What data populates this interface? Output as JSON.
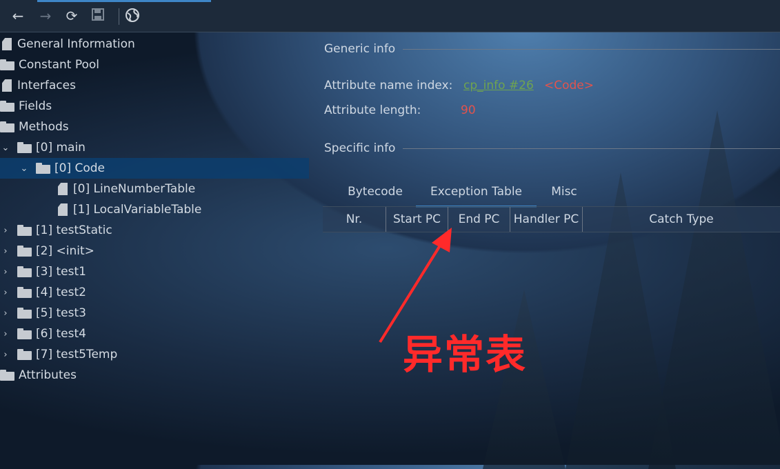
{
  "toolbar": {
    "icons": [
      "back-arrow-icon",
      "forward-arrow-icon",
      "refresh-icon",
      "save-icon",
      "globe-icon"
    ]
  },
  "tree": {
    "items": [
      {
        "label": "General Information"
      },
      {
        "label": "Constant Pool"
      },
      {
        "label": "Interfaces"
      },
      {
        "label": "Fields"
      },
      {
        "label": "Methods"
      },
      {
        "label": "[0] main"
      },
      {
        "label": "[0] Code"
      },
      {
        "label": "[0] LineNumberTable"
      },
      {
        "label": "[1] LocalVariableTable"
      },
      {
        "label": "[1] testStatic"
      },
      {
        "label": "[2] <init>"
      },
      {
        "label": "[3] test1"
      },
      {
        "label": "[4] test2"
      },
      {
        "label": "[5] test3"
      },
      {
        "label": "[6] test4"
      },
      {
        "label": "[7] test5Temp"
      },
      {
        "label": "Attributes"
      }
    ]
  },
  "generic": {
    "title": "Generic info",
    "name_index_label": "Attribute name index:",
    "name_index_link": "cp_info #26",
    "name_index_value": "<Code>",
    "length_label": "Attribute length:",
    "length_value": "90"
  },
  "specific": {
    "title": "Specific info",
    "tabs": [
      "Bytecode",
      "Exception Table",
      "Misc"
    ],
    "columns": [
      "Nr.",
      "Start PC",
      "End PC",
      "Handler PC",
      "Catch Type"
    ]
  },
  "annotation": {
    "text": "异常表",
    "color": "#ff2a2a"
  }
}
